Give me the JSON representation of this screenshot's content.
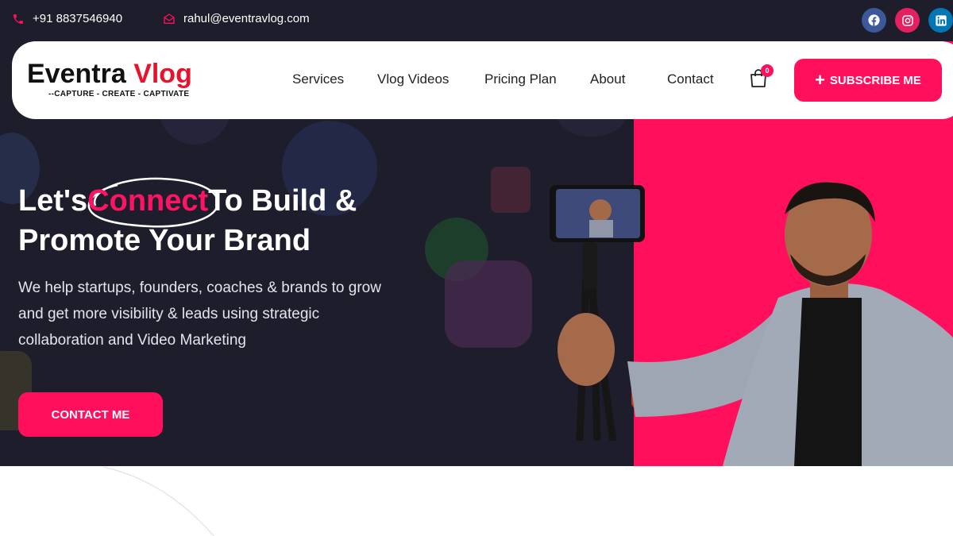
{
  "topbar": {
    "phone": "+91 8837546940",
    "email": "rahul@eventravlog.com",
    "social": [
      {
        "icon": "facebook-icon",
        "color": "#3b5998"
      },
      {
        "icon": "instagram-icon",
        "color": "#e4405f"
      },
      {
        "icon": "linkedin-icon",
        "color": "#0077b5"
      }
    ]
  },
  "logo": {
    "word1": "Eventra",
    "word2": "Vlog",
    "tagline": "--CAPTURE - CREATE - CAPTIVATE"
  },
  "nav": {
    "items": [
      "Services",
      "Vlog Videos",
      "Pricing Plan",
      "About",
      "Contact"
    ]
  },
  "cart": {
    "count": "0"
  },
  "subscribe": {
    "label": "SUBSCRIBE ME"
  },
  "hero": {
    "headline_pre": "Let's",
    "headline_highlight": "Connect",
    "headline_post": "To Build &",
    "headline_line2": "Promote Your Brand",
    "subtext": "We help startups, founders, coaches & brands to grow and get more visibility & leads using strategic collaboration and Video Marketing",
    "cta_label": "CONTACT ME"
  },
  "colors": {
    "accent": "#ff0f5c",
    "dark": "#1e1d2b",
    "logo_red": "#e8132b"
  }
}
